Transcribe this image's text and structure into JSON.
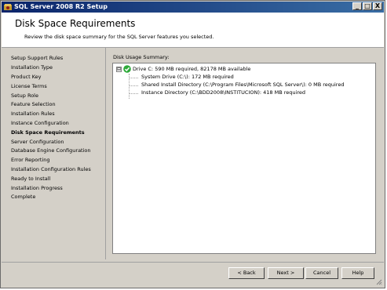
{
  "window": {
    "title": "SQL Server 2008 R2 Setup",
    "buttons": [
      "_",
      "□",
      "X"
    ]
  },
  "header": {
    "title": "Disk Space Requirements",
    "subtitle": "Review the disk space summary for the SQL Server features you selected."
  },
  "sidebar": {
    "items": [
      {
        "label": "Setup Support Rules"
      },
      {
        "label": "Installation Type"
      },
      {
        "label": "Product Key"
      },
      {
        "label": "License Terms"
      },
      {
        "label": "Setup Role"
      },
      {
        "label": "Feature Selection"
      },
      {
        "label": "Installation Rules"
      },
      {
        "label": "Instance Configuration"
      },
      {
        "label": "Disk Space Requirements",
        "active": true
      },
      {
        "label": "Server Configuration"
      },
      {
        "label": "Database Engine Configuration"
      },
      {
        "label": "Error Reporting"
      },
      {
        "label": "Installation Configuration Rules"
      },
      {
        "label": "Ready to Install"
      },
      {
        "label": "Installation Progress"
      },
      {
        "label": "Complete"
      }
    ]
  },
  "main": {
    "summary_label": "Disk Usage Summary:",
    "tree": {
      "expander": "⊟",
      "root": "Drive C: 590 MB required, 82178 MB available",
      "children": [
        "System Drive (C:\\): 172 MB required",
        "Shared Install Directory (C:\\Program Files\\Microsoft SQL Server\\): 0 MB required",
        "Instance Directory (C:\\BDD2008\\INSTITUCION): 418 MB required"
      ]
    }
  },
  "footer": {
    "back_label": "< Back",
    "next_label": "Next >",
    "cancel_label": "Cancel",
    "help_label": "Help"
  },
  "colors": {
    "titlebar_start": "#0a246a",
    "titlebar_end": "#3a6ea5",
    "dialog_bg": "#d4d0c8",
    "check_green": "#2eaa3a"
  }
}
